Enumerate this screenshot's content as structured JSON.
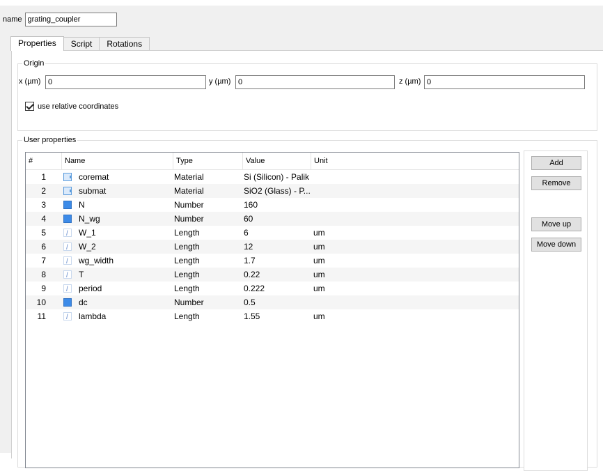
{
  "header": {
    "name_label": "name",
    "name_value": "grating_coupler"
  },
  "tabs": [
    {
      "label": "Properties",
      "active": true
    },
    {
      "label": "Script",
      "active": false
    },
    {
      "label": "Rotations",
      "active": false
    }
  ],
  "origin": {
    "title": "Origin",
    "x_label": "x (µm)",
    "x_value": "0",
    "y_label": "y (µm)",
    "y_value": "0",
    "z_label": "z (µm)",
    "z_value": "0",
    "relative_label": "use relative coordinates",
    "relative_checked": true
  },
  "user_properties": {
    "title": "User properties",
    "columns": {
      "num": "#",
      "name": "Name",
      "type": "Type",
      "value": "Value",
      "unit": "Unit"
    },
    "rows": [
      {
        "num": "1",
        "icon": "material-icon",
        "name": "coremat",
        "type": "Material",
        "value": "Si (Silicon) - Palik",
        "unit": ""
      },
      {
        "num": "2",
        "icon": "material-icon",
        "name": "submat",
        "type": "Material",
        "value": "SiO2 (Glass) - P...",
        "unit": ""
      },
      {
        "num": "3",
        "icon": "number-icon",
        "name": "N",
        "type": "Number",
        "value": "160",
        "unit": ""
      },
      {
        "num": "4",
        "icon": "number-icon",
        "name": "N_wg",
        "type": "Number",
        "value": "60",
        "unit": ""
      },
      {
        "num": "5",
        "icon": "length-icon",
        "name": "W_1",
        "type": "Length",
        "value": "6",
        "unit": "um"
      },
      {
        "num": "6",
        "icon": "length-icon",
        "name": "W_2",
        "type": "Length",
        "value": "12",
        "unit": "um"
      },
      {
        "num": "7",
        "icon": "length-icon",
        "name": "wg_width",
        "type": "Length",
        "value": "1.7",
        "unit": "um"
      },
      {
        "num": "8",
        "icon": "length-icon",
        "name": "T",
        "type": "Length",
        "value": "0.22",
        "unit": "um"
      },
      {
        "num": "9",
        "icon": "length-icon",
        "name": "period",
        "type": "Length",
        "value": "0.222",
        "unit": "um"
      },
      {
        "num": "10",
        "icon": "number-icon",
        "name": "dc",
        "type": "Number",
        "value": "0.5",
        "unit": ""
      },
      {
        "num": "11",
        "icon": "length-icon",
        "name": "lambda",
        "type": "Length",
        "value": "1.55",
        "unit": "um"
      }
    ],
    "buttons": {
      "add": "Add",
      "remove": "Remove",
      "move_up": "Move up",
      "move_down": "Move down"
    }
  }
}
